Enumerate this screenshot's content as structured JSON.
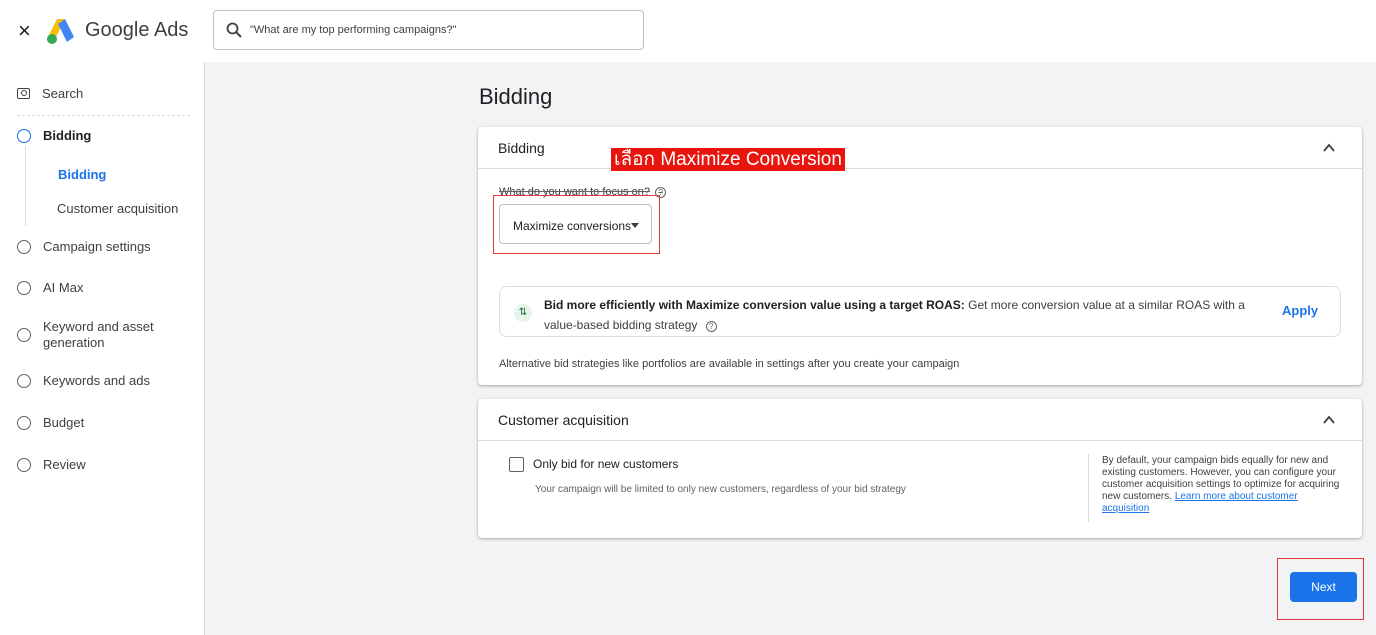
{
  "topbar": {
    "close": "×",
    "brand": "Google Ads",
    "search_placeholder": "\"What are my top performing campaigns?\""
  },
  "sidebar": {
    "search": "Search",
    "steps": {
      "bidding": "Bidding",
      "bidding_sub": "Bidding",
      "customer_acq_sub": "Customer acquisition",
      "campaign_settings": "Campaign settings",
      "ai_max": "AI Max",
      "keyword_asset": "Keyword and asset generation",
      "keywords_ads": "Keywords and ads",
      "budget": "Budget",
      "review": "Review"
    }
  },
  "main": {
    "page_title": "Bidding",
    "bidding_card": {
      "title": "Bidding",
      "annotation": "เลือก Maximize Conversion",
      "focus_label": "What do you want to focus on?",
      "selected": "Maximize conversions",
      "suggestion_bold": "Bid more efficiently with Maximize conversion value using a target ROAS:",
      "suggestion_text": "Get more conversion value at a similar ROAS with a value-based bidding strategy",
      "apply": "Apply",
      "alt_note": "Alternative bid strategies like portfolios are available in settings after you create your campaign"
    },
    "customer_card": {
      "title": "Customer acquisition",
      "checkbox_label": "Only bid for new customers",
      "checkbox_desc": "Your campaign will be limited to only new customers, regardless of your bid strategy",
      "side_note": "By default, your campaign bids equally for new and existing customers. However, you can configure your customer acquisition settings to optimize for acquiring new customers.",
      "learn_more": "Learn more about customer acquisition"
    },
    "next": "Next"
  },
  "colors": {
    "accent": "#1a73e8",
    "annotation": "#e8150f"
  }
}
